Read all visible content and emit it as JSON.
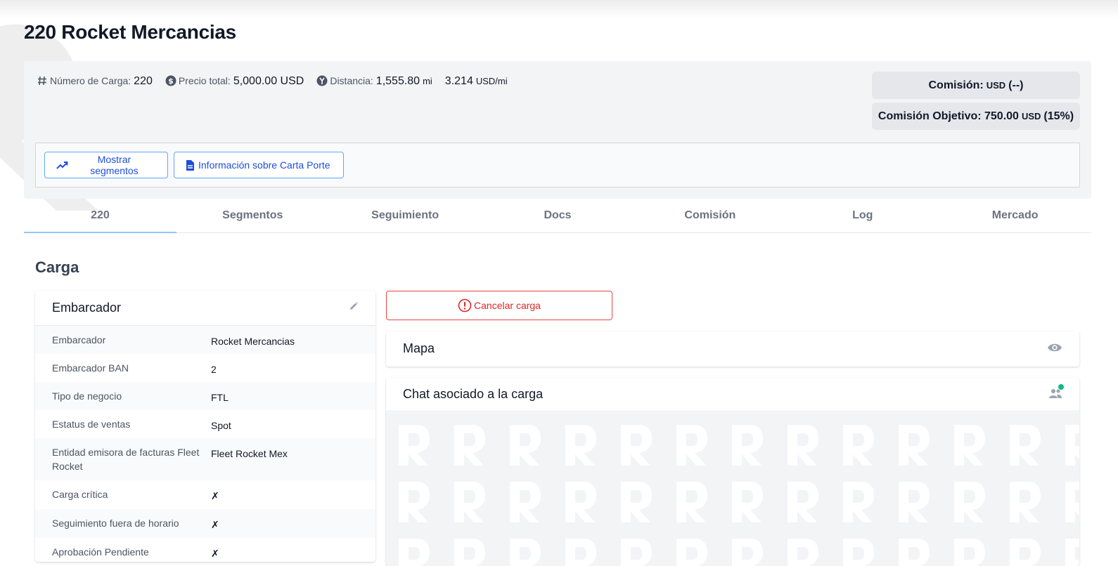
{
  "page": {
    "title": "220 Rocket Mercancias"
  },
  "summary": {
    "load_number_label": "Número de Carga:",
    "load_number": "220",
    "total_price_label": "Precio total:",
    "total_price": "5,000.00 USD",
    "distance_label": "Distancia:",
    "distance": "1,555.80",
    "distance_unit": "mi",
    "rate": "3.214",
    "rate_unit": "USD/mi",
    "commission_label": "Comisión:",
    "commission_currency": "USD",
    "commission_value": "(--)",
    "target_label": "Comisión Objetivo: 750.00",
    "target_currency": "USD",
    "target_pct": "(15%)"
  },
  "actions": {
    "show_segments": "Mostrar segmentos",
    "carta_porte": "Información sobre Carta Porte",
    "cancel_load": "Cancelar carga"
  },
  "tabs": [
    "220",
    "Segmentos",
    "Seguimiento",
    "Docs",
    "Comisión",
    "Log",
    "Mercado"
  ],
  "section": {
    "title": "Carga"
  },
  "shipper_card": {
    "title": "Embarcador",
    "rows": [
      {
        "key": "Embarcador",
        "value": "Rocket Mercancias"
      },
      {
        "key": "Embarcador BAN",
        "value": "2"
      },
      {
        "key": "Tipo de negocio",
        "value": "FTL"
      },
      {
        "key": "Estatus de ventas",
        "value": "Spot"
      },
      {
        "key": "Entidad emisora de facturas Fleet Rocket",
        "value": "Fleet Rocket Mex"
      },
      {
        "key": "Carga crítica",
        "value": "✗"
      },
      {
        "key": "Seguimiento fuera de horario",
        "value": "✗"
      },
      {
        "key": "Aprobación Pendiente",
        "value": "✗"
      }
    ]
  },
  "map_panel": {
    "title": "Mapa"
  },
  "chat_panel": {
    "title": "Chat asociado a la carga"
  },
  "colors": {
    "accent_blue": "#1d4ed8",
    "danger_red": "#dc2626",
    "online_green": "#10b981"
  }
}
